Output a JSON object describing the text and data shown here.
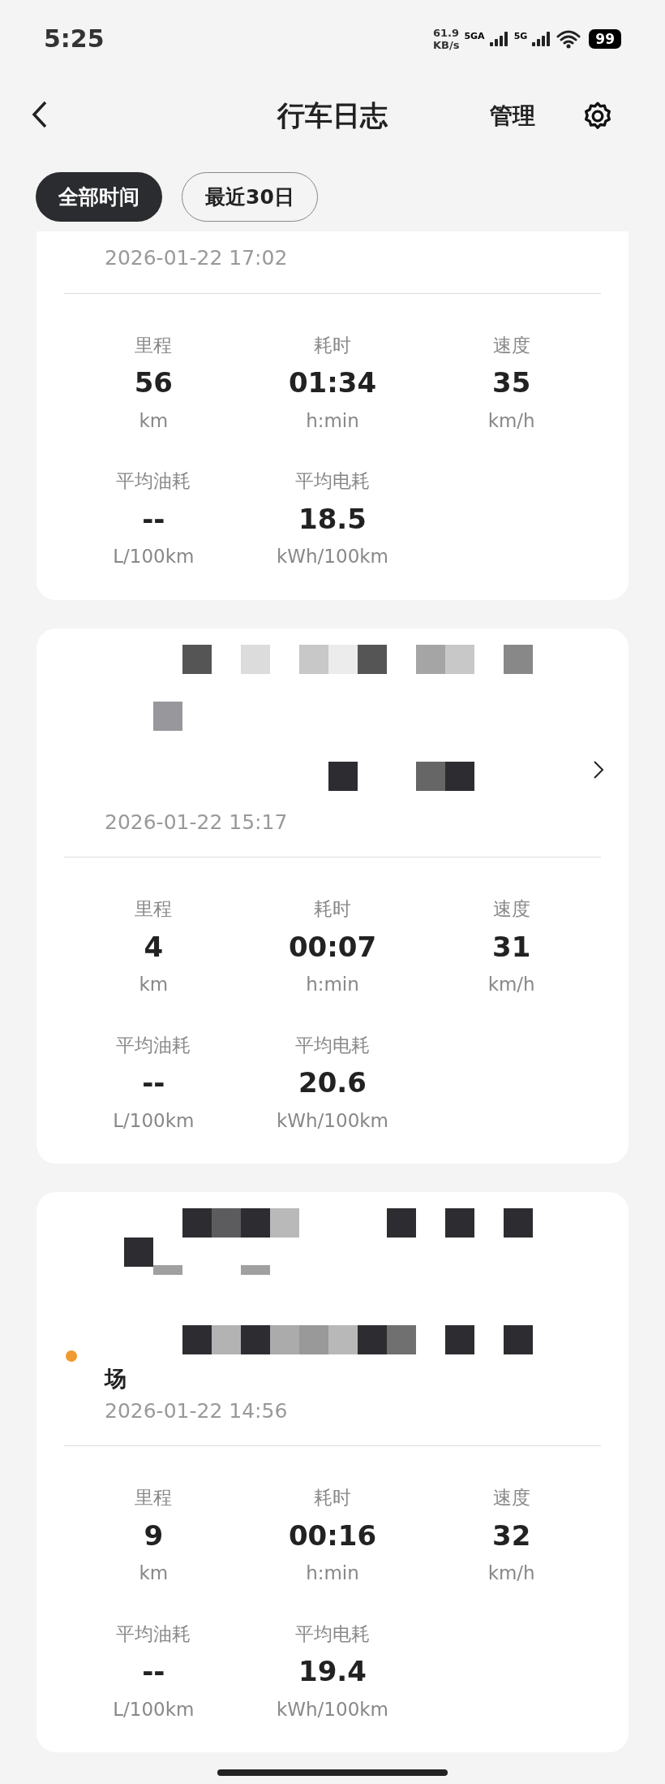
{
  "status_bar": {
    "time": "5:25",
    "net_speed": "61.9",
    "net_unit": "KB/s",
    "sim1": "5GA",
    "sim2": "5G",
    "battery": "99"
  },
  "header": {
    "title": "行车日志",
    "action": "管理"
  },
  "filters": [
    {
      "label": "全部时间",
      "selected": true
    },
    {
      "label": "最近30日",
      "selected": false
    }
  ],
  "trips": [
    {
      "cut_top": true,
      "redacted": false,
      "chevron": false,
      "datetime": "2026-01-22 17:02",
      "metrics": [
        {
          "label": "里程",
          "value": "56",
          "unit": "km"
        },
        {
          "label": "耗时",
          "value": "01:34",
          "unit": "h:min"
        },
        {
          "label": "速度",
          "value": "35",
          "unit": "km/h"
        },
        {
          "label": "平均油耗",
          "value": "--",
          "unit": "L/100km"
        },
        {
          "label": "平均电耗",
          "value": "18.5",
          "unit": "kWh/100km"
        }
      ]
    },
    {
      "cut_top": false,
      "redacted": true,
      "chevron": true,
      "datetime": "2026-01-22 15:17",
      "metrics": [
        {
          "label": "里程",
          "value": "4",
          "unit": "km"
        },
        {
          "label": "耗时",
          "value": "00:07",
          "unit": "h:min"
        },
        {
          "label": "速度",
          "value": "31",
          "unit": "km/h"
        },
        {
          "label": "平均油耗",
          "value": "--",
          "unit": "L/100km"
        },
        {
          "label": "平均电耗",
          "value": "20.6",
          "unit": "kWh/100km"
        }
      ]
    },
    {
      "cut_top": false,
      "redacted": true,
      "chevron": false,
      "color": "#f09a30",
      "place": "场",
      "datetime": "2026-01-22 14:56",
      "metrics": [
        {
          "label": "里程",
          "value": "9",
          "unit": "km"
        },
        {
          "label": "耗时",
          "value": "00:16",
          "unit": "h:min"
        },
        {
          "label": "速度",
          "value": "32",
          "unit": "km/h"
        },
        {
          "label": "平均油耗",
          "value": "--",
          "unit": "L/100km"
        },
        {
          "label": "平均电耗",
          "value": "19.4",
          "unit": "kWh/100km"
        }
      ]
    }
  ]
}
